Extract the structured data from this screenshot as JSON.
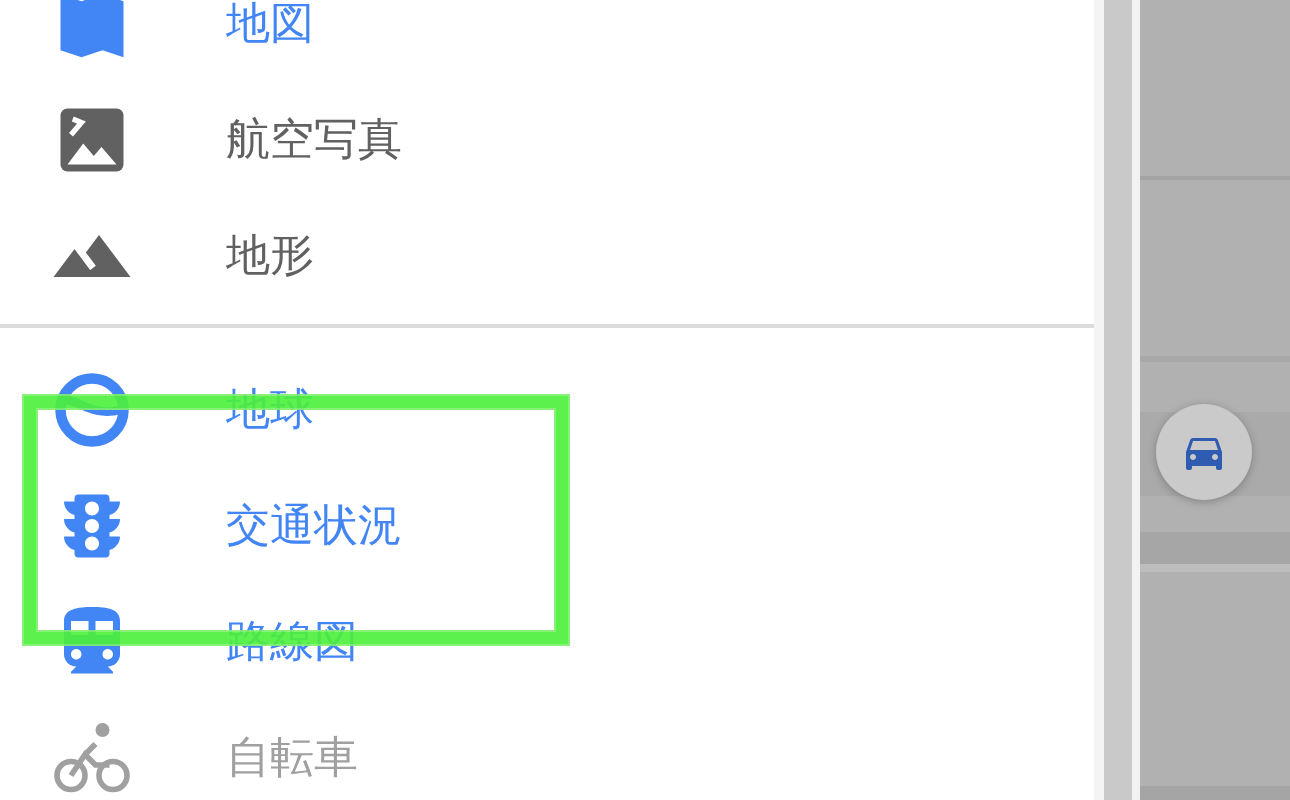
{
  "base_layers": [
    {
      "kind": "map",
      "label": "地図",
      "selected": true
    },
    {
      "kind": "satellite",
      "label": "航空写真",
      "selected": false
    },
    {
      "kind": "terrain",
      "label": "地形",
      "selected": false
    }
  ],
  "overlays": [
    {
      "kind": "earth",
      "label": "地球",
      "on": true
    },
    {
      "kind": "traffic",
      "label": "交通状況",
      "on": true
    },
    {
      "kind": "transit",
      "label": "路線図",
      "on": true
    },
    {
      "kind": "bike",
      "label": "自転車",
      "on": false
    }
  ]
}
